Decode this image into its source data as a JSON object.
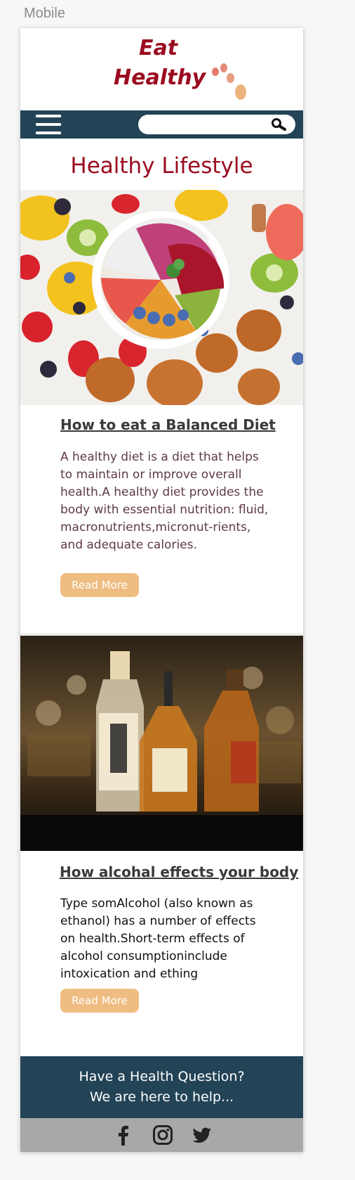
{
  "canvas": {
    "label": "Mobile"
  },
  "logo": {
    "line1": "Eat",
    "line2": "Healthy"
  },
  "nav": {
    "search_placeholder": ""
  },
  "page": {
    "title": "Healthy Lifestyle"
  },
  "articles": [
    {
      "heading": "How to eat a Balanced Diet",
      "body": "A healthy diet is a diet that helps to maintain or improve overall health.A healthy diet provides the body with essential nutrition: fluid, macronutrients,micronut-rients, and adequate calories.",
      "button": "Read More",
      "image": "healthy-food-bowl-photo"
    },
    {
      "heading": "How alcohal effects your body",
      "body": "Type somAlcohol (also known as ethanol) has a number of effects on health.Short-term effects of alcohol consumptioninclude intoxication and ething",
      "button": "Read More",
      "image": "whisky-bottles-photo"
    }
  ],
  "footer": {
    "line1": "Have a Health Question?",
    "line2": "We are here to help...",
    "social": [
      "facebook-icon",
      "instagram-icon",
      "twitter-icon"
    ]
  },
  "colors": {
    "brand_red": "#9b0b1f",
    "nav_bg": "#234356",
    "button": "#efbd82",
    "social_bar": "#a8a8a8"
  }
}
